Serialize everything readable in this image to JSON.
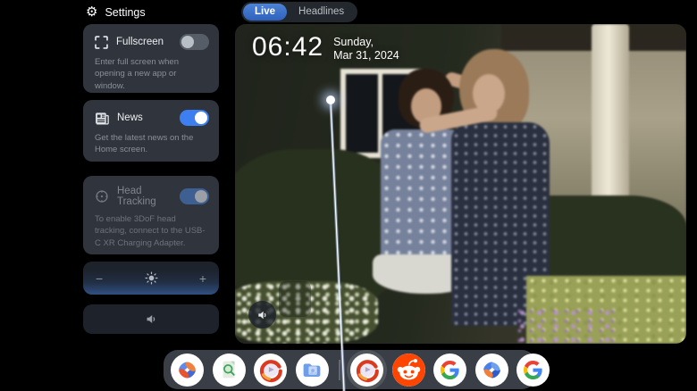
{
  "header": {
    "title": "Settings"
  },
  "settings_panel": {
    "cards": [
      {
        "label": "Fullscreen",
        "description": "Enter full screen when opening a new app or window.",
        "toggle_on": false,
        "enabled": true
      },
      {
        "label": "News",
        "description": "Get the latest news on the Home screen.",
        "toggle_on": true,
        "enabled": true
      },
      {
        "label": "Head Tracking",
        "description": "To enable 3DoF head tracking, connect to the USB-C XR Charging Adapter.",
        "toggle_on": true,
        "enabled": false
      }
    ],
    "brightness": {
      "minus": "−",
      "plus": "+"
    }
  },
  "tabs": {
    "items": [
      {
        "label": "Live",
        "active": true
      },
      {
        "label": "Headlines",
        "active": false
      }
    ]
  },
  "video": {
    "time": "06:42",
    "day": "Sunday,",
    "date": "Mar 31, 2024",
    "content": "archival photo of two girls hugging in front of a house garden"
  },
  "dock": {
    "items": [
      {
        "name": "nebula-app"
      },
      {
        "name": "file-search-app"
      },
      {
        "name": "media-player-app"
      },
      {
        "name": "photos-app"
      },
      {
        "name": "media-player-app"
      },
      {
        "name": "reddit-app"
      },
      {
        "name": "google-app"
      },
      {
        "name": "nebula-blue-app"
      },
      {
        "name": "google-app"
      }
    ]
  },
  "colors": {
    "accent_blue": "#3d7ef0",
    "toggle_off": "#575d66",
    "panel_card": "#30343c",
    "pill_dark": "#1d222b",
    "dock_bg": "#3a3f47",
    "background": "#000000"
  }
}
